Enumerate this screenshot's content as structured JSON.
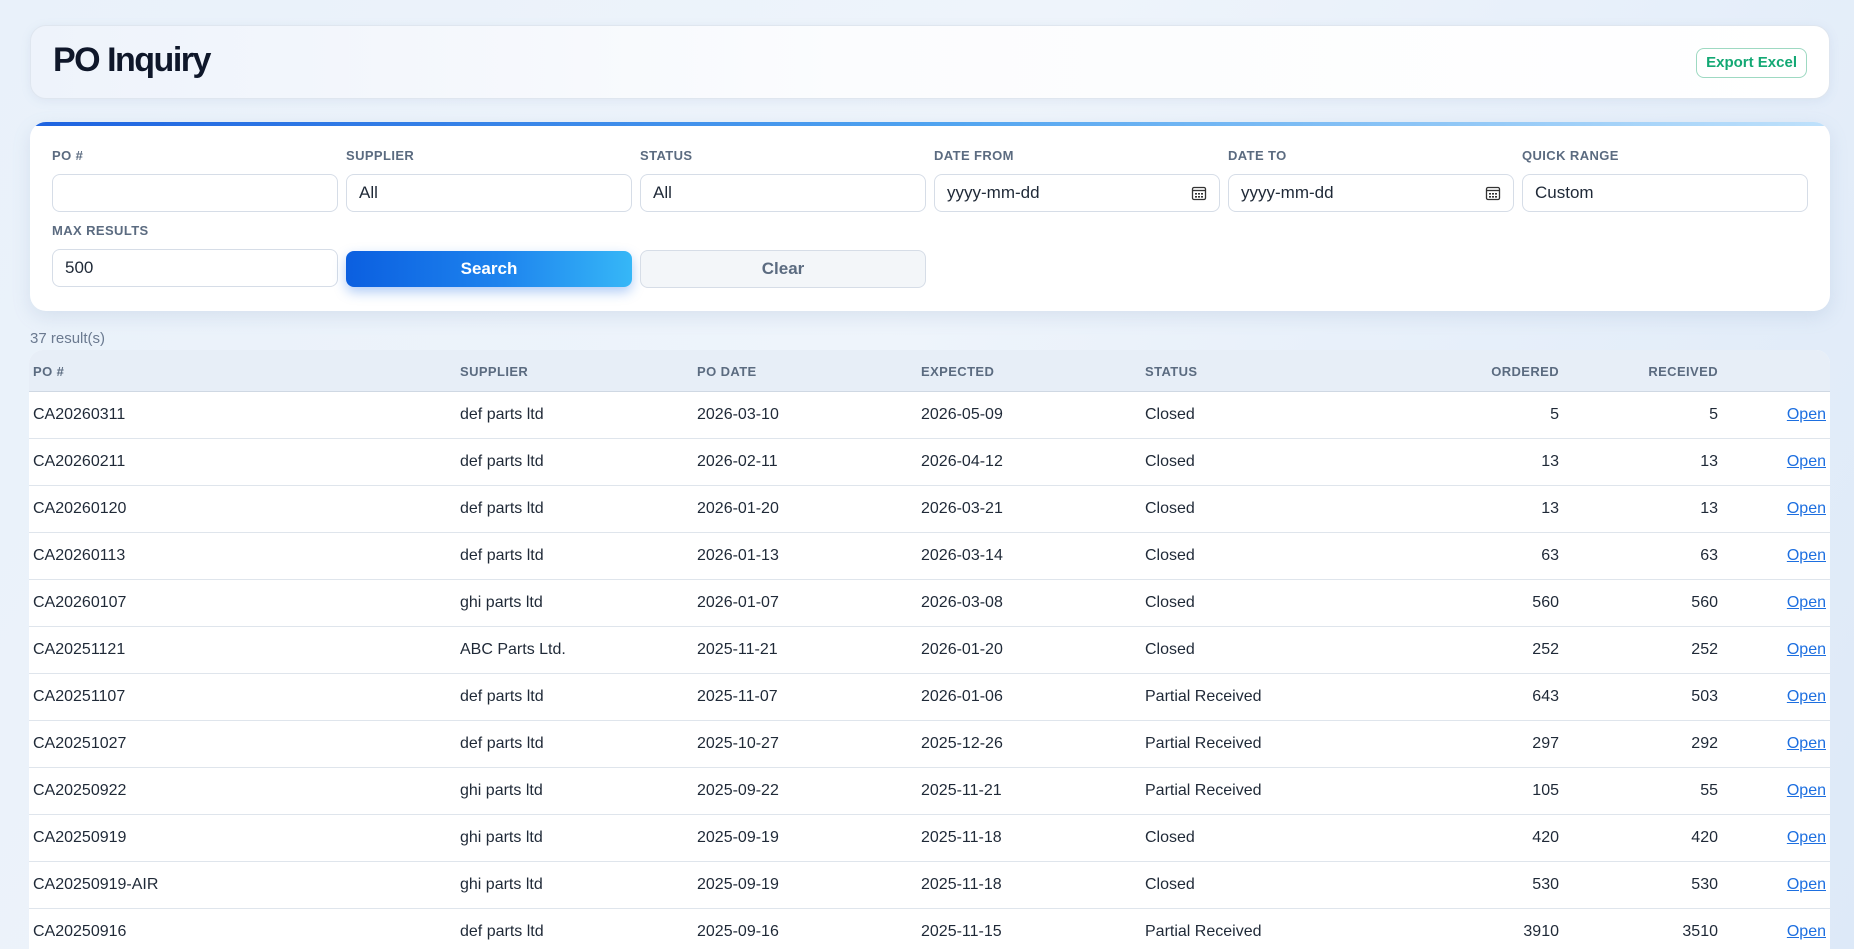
{
  "header": {
    "title": "PO Inquiry",
    "export_label": "Export Excel"
  },
  "filters": {
    "po_label": "PO #",
    "po_value": "",
    "supplier_label": "SUPPLIER",
    "supplier_value": "All",
    "status_label": "STATUS",
    "status_value": "All",
    "date_from_label": "DATE FROM",
    "date_from_value": "yyyy-mm-dd",
    "date_to_label": "DATE TO",
    "date_to_value": "yyyy-mm-dd",
    "quick_range_label": "QUICK RANGE",
    "quick_range_value": "Custom",
    "max_results_label": "MAX RESULTS",
    "max_results_value": "500",
    "search_label": "Search",
    "clear_label": "Clear"
  },
  "results": {
    "count_text": "37 result(s)"
  },
  "table": {
    "columns": {
      "po": "PO #",
      "supplier": "SUPPLIER",
      "po_date": "PO DATE",
      "expected": "EXPECTED",
      "status": "STATUS",
      "ordered": "ORDERED",
      "received": "RECEIVED"
    },
    "open_label": "Open",
    "rows": [
      {
        "po": "CA20260311",
        "supplier": "def parts ltd",
        "po_date": "2026-03-10",
        "expected": "2026-05-09",
        "status": "Closed",
        "ordered": "5",
        "received": "5"
      },
      {
        "po": "CA20260211",
        "supplier": "def parts ltd",
        "po_date": "2026-02-11",
        "expected": "2026-04-12",
        "status": "Closed",
        "ordered": "13",
        "received": "13"
      },
      {
        "po": "CA20260120",
        "supplier": "def parts ltd",
        "po_date": "2026-01-20",
        "expected": "2026-03-21",
        "status": "Closed",
        "ordered": "13",
        "received": "13"
      },
      {
        "po": "CA20260113",
        "supplier": "def parts ltd",
        "po_date": "2026-01-13",
        "expected": "2026-03-14",
        "status": "Closed",
        "ordered": "63",
        "received": "63"
      },
      {
        "po": "CA20260107",
        "supplier": "ghi parts ltd",
        "po_date": "2026-01-07",
        "expected": "2026-03-08",
        "status": "Closed",
        "ordered": "560",
        "received": "560"
      },
      {
        "po": "CA20251121",
        "supplier": "ABC Parts Ltd.",
        "po_date": "2025-11-21",
        "expected": "2026-01-20",
        "status": "Closed",
        "ordered": "252",
        "received": "252"
      },
      {
        "po": "CA20251107",
        "supplier": "def parts ltd",
        "po_date": "2025-11-07",
        "expected": "2026-01-06",
        "status": "Partial Received",
        "ordered": "643",
        "received": "503"
      },
      {
        "po": "CA20251027",
        "supplier": "def parts ltd",
        "po_date": "2025-10-27",
        "expected": "2025-12-26",
        "status": "Partial Received",
        "ordered": "297",
        "received": "292"
      },
      {
        "po": "CA20250922",
        "supplier": "ghi parts ltd",
        "po_date": "2025-09-22",
        "expected": "2025-11-21",
        "status": "Partial Received",
        "ordered": "105",
        "received": "55"
      },
      {
        "po": "CA20250919",
        "supplier": "ghi parts ltd",
        "po_date": "2025-09-19",
        "expected": "2025-11-18",
        "status": "Closed",
        "ordered": "420",
        "received": "420"
      },
      {
        "po": "CA20250919-AIR",
        "supplier": "ghi parts ltd",
        "po_date": "2025-09-19",
        "expected": "2025-11-18",
        "status": "Closed",
        "ordered": "530",
        "received": "530"
      },
      {
        "po": "CA20250916",
        "supplier": "def parts ltd",
        "po_date": "2025-09-16",
        "expected": "2025-11-15",
        "status": "Partial Received",
        "ordered": "3910",
        "received": "3510"
      }
    ]
  }
}
